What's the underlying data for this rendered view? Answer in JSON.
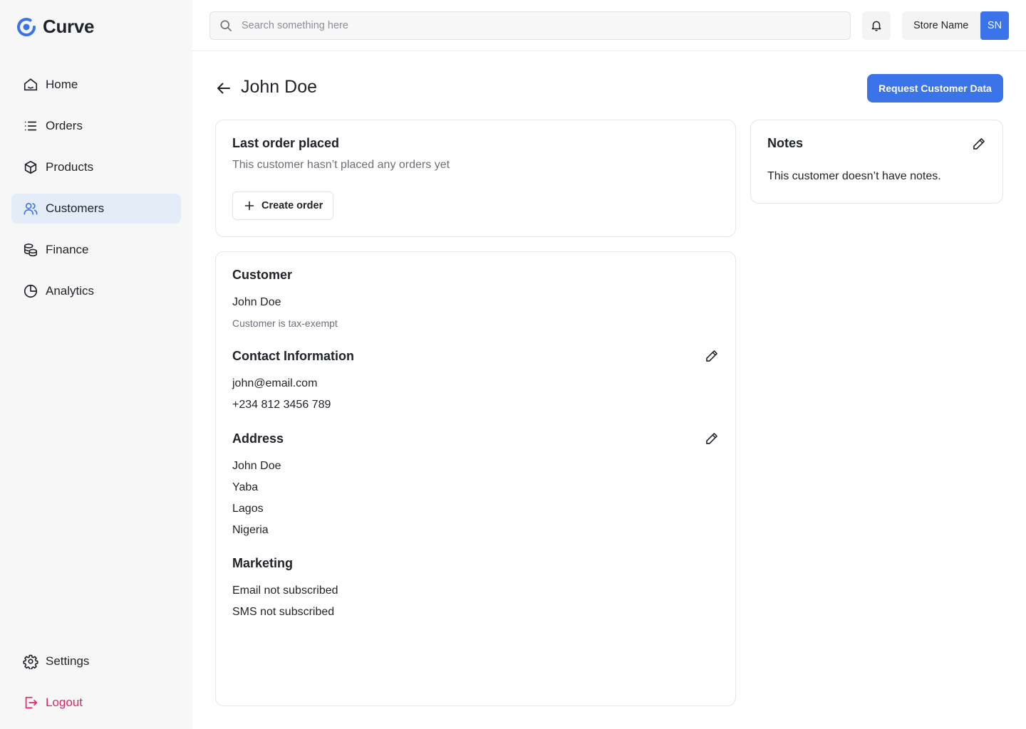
{
  "app": {
    "name": "Curve",
    "brand_color": "#3b73e8"
  },
  "sidebar": {
    "items": [
      {
        "label": "Home",
        "icon": "home-icon"
      },
      {
        "label": "Orders",
        "icon": "list-icon"
      },
      {
        "label": "Products",
        "icon": "box-icon"
      },
      {
        "label": "Customers",
        "icon": "users-icon",
        "active": true
      },
      {
        "label": "Finance",
        "icon": "coins-icon"
      },
      {
        "label": "Analytics",
        "icon": "pie-chart-icon"
      }
    ],
    "settings_label": "Settings",
    "logout_label": "Logout",
    "logout_color": "#e0245e",
    "active_bg": "#e4ecf8"
  },
  "topbar": {
    "search_placeholder": "Search something here",
    "store_name": "Store Name",
    "avatar_initials": "SN"
  },
  "page": {
    "title": "John Doe",
    "request_button": "Request Customer Data"
  },
  "last_order": {
    "title": "Last order placed",
    "message": "This customer hasn’t placed any orders yet",
    "create_button": "Create order"
  },
  "customer": {
    "title": "Customer",
    "name": "John Doe",
    "tax_note": "Customer is tax-exempt",
    "contact": {
      "title": "Contact Information",
      "email": "john@email.com",
      "phone": "+234 812 3456 789"
    },
    "address": {
      "title": "Address",
      "lines": [
        "John Doe",
        "Yaba",
        "Lagos",
        "Nigeria"
      ]
    },
    "marketing": {
      "title": "Marketing",
      "email_status": "Email not subscribed",
      "sms_status": "SMS not subscribed"
    }
  },
  "notes": {
    "title": "Notes",
    "message": "This customer doesn’t have notes."
  }
}
